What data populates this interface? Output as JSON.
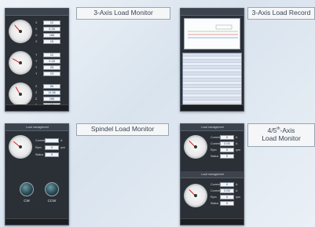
{
  "titles": {
    "axis3_monitor": "3-Axis Load Monitor",
    "axis3_record": "3-Axis Load Record",
    "spindle_monitor": "Spindel Load Monitor",
    "axis45_line1": "4/5",
    "axis45_sup": "th",
    "axis45_line1_tail": "-Axis",
    "axis45_line2": "Load Monitor"
  },
  "panel_tl": {
    "rows": [
      {
        "label": "X",
        "value": "12"
      },
      {
        "label": "X",
        "value": "0.28"
      },
      {
        "label": "X",
        "value": "166"
      },
      {
        "label": "X",
        "value": "15"
      },
      {
        "label": "Y",
        "value": "12"
      },
      {
        "label": "Y",
        "value": "0.18"
      },
      {
        "label": "Y",
        "value": "25"
      },
      {
        "label": "Y",
        "value": "13"
      },
      {
        "label": "Z",
        "value": "86"
      },
      {
        "label": "Z",
        "value": "11.38"
      },
      {
        "label": "Z",
        "value": "166"
      },
      {
        "label": "Z",
        "value": "15"
      }
    ]
  },
  "panel_bl": {
    "header": "Load management",
    "rows": [
      {
        "label": "Current",
        "value": "",
        "unit": "A"
      },
      {
        "label": "Rpm",
        "value": "0",
        "unit": "rpm"
      },
      {
        "label": "Status",
        "value": "0",
        "unit": ""
      }
    ],
    "cw_label": "CW",
    "ccw_label": "CCW"
  },
  "panel_br": {
    "header": "Load management",
    "rows_a": [
      {
        "label": "Current",
        "value": "0",
        "unit": "A"
      },
      {
        "label": "Current",
        "value": "0.00",
        "unit": "A"
      },
      {
        "label": "Rpm",
        "value": "0",
        "unit": "rpm"
      },
      {
        "label": "Status",
        "value": "0",
        "unit": ""
      }
    ],
    "rows_b": [
      {
        "label": "Current",
        "value": "0",
        "unit": "A"
      },
      {
        "label": "Current",
        "value": "0.00",
        "unit": "A"
      },
      {
        "label": "Rpm",
        "value": "0",
        "unit": "rpm"
      },
      {
        "label": "Status",
        "value": "0",
        "unit": ""
      }
    ]
  }
}
